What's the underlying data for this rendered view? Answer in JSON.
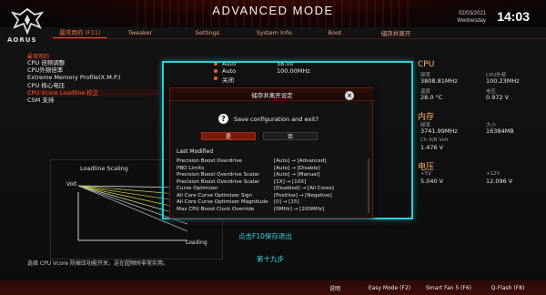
{
  "header": {
    "mode_title": "ADVANCED MODE",
    "date": "02/03/2021",
    "weekday": "Wednesday",
    "time": "14:03",
    "logo_text": "AORUS",
    "accent": "#ff5a2a"
  },
  "tabs": [
    {
      "label": "最常用的 (F11)",
      "active": true
    },
    {
      "label": "Tweaker",
      "active": false
    },
    {
      "label": "Settings",
      "active": false
    },
    {
      "label": "System Info.",
      "active": false
    },
    {
      "label": "Boot",
      "active": false
    },
    {
      "label": "储存并离开",
      "active": false
    }
  ],
  "left": {
    "section": "最常用的",
    "items": [
      {
        "label": "CPU 倍频调整"
      },
      {
        "label": "CPU外频倍率"
      },
      {
        "label": "Extreme Memory Profile(X.M.P.)"
      },
      {
        "label": "CPU 核心电压"
      },
      {
        "label": "CPU Vcore Loadline 校正"
      },
      {
        "label": "CSM 支持"
      }
    ],
    "values": [
      {
        "a": "Auto",
        "b": "38.00"
      },
      {
        "a": "Auto",
        "b": "100.00MHz"
      },
      {
        "a": "关闭",
        "b": ""
      }
    ]
  },
  "side": {
    "cpu": {
      "title": "CPU",
      "freq_label": "频率",
      "freq": "3808.81MHz",
      "bclk_label": "CPU外频",
      "bclk": "100.23MHz",
      "temp_label": "温度",
      "temp": "28.0 °C",
      "volt_label": "电压",
      "volt": "0.972 V"
    },
    "memory": {
      "title": "内存",
      "freq_label": "频率",
      "freq": "3741.99MHz",
      "size_label": "大小",
      "size": "16384MB",
      "ab_label": "Ch A/B Volt",
      "ab": "1.476 V"
    },
    "voltage": {
      "title": "电压",
      "p5_label": "+5V",
      "p5": "5.040 V",
      "p12_label": "+12V",
      "p12": "12.096 V"
    }
  },
  "graph": {
    "title": "Loadline Scaling",
    "ylabel": "Volt",
    "xlabel": "Loading"
  },
  "dialog": {
    "title": "储存并离开设定",
    "question": "Save configuration and exit?",
    "yes": "是",
    "no": "否",
    "last_modified": "Last Modified",
    "changes": [
      {
        "name": "Precision Boost Overdrive",
        "value": "[Auto] → [Advanced]"
      },
      {
        "name": "PBO Limits",
        "value": "[Auto] → [Disable]"
      },
      {
        "name": "Precision Boost Overdrive Scalar",
        "value": "[Auto] → [Manual]"
      },
      {
        "name": "Precision Boost Overdrive Scalar",
        "value": "[1X] → [10X]"
      },
      {
        "name": "Curve Optimizer",
        "value": "[Disabled] → [All Cores]"
      },
      {
        "name": "All Core Curve Optimizer Sign",
        "value": "[Positive] → [Negative]"
      },
      {
        "name": "All Core Curve Optimizer Magnitude",
        "value": "[0] → [15]"
      },
      {
        "name": "Max CPU Boost Clock Override",
        "value": "[0MHz] → [200MHz]"
      }
    ]
  },
  "captions": {
    "save": "点击F10保存退出",
    "step": "第十九步"
  },
  "help_text": "选择 CPU Vcore 防掉压功能开关，这在超频时非常实用。",
  "bottom": {
    "btn1": "说明",
    "btn2": "Easy Mode (F2)",
    "btn3": "Smart Fan 5 (F6)",
    "btn4": "Q-Flash (F8)"
  }
}
